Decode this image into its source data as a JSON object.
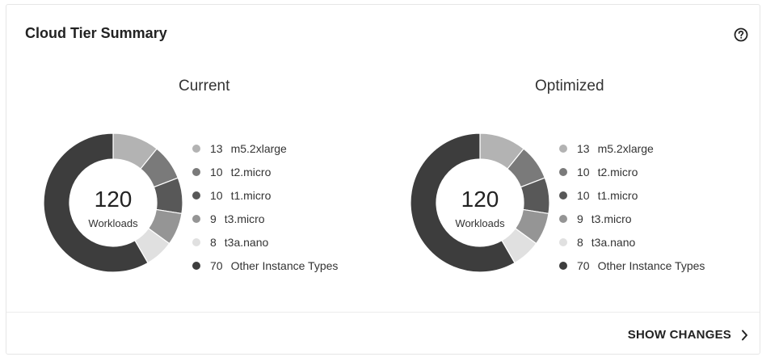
{
  "card": {
    "title": "Cloud Tier Summary",
    "help_icon": "help-circle-icon"
  },
  "footer": {
    "link_label": "SHOW CHANGES",
    "link_icon": "chevron-right-icon"
  },
  "colors": {
    "m5.2xlarge": "#b3b3b3",
    "t2.micro": "#7a7a7a",
    "t1.micro": "#585858",
    "t3.micro": "#959595",
    "t3a.nano": "#e0e0e0",
    "Other Instance Types": "#3d3d3d"
  },
  "panels": [
    {
      "title": "Current",
      "center_value": "120",
      "center_label": "Workloads",
      "legend": [
        {
          "count": "13",
          "name": "m5.2xlarge"
        },
        {
          "count": "10",
          "name": "t2.micro"
        },
        {
          "count": "10",
          "name": "t1.micro"
        },
        {
          "count": "9",
          "name": "t3.micro"
        },
        {
          "count": "8",
          "name": "t3a.nano"
        },
        {
          "count": "70",
          "name": "Other Instance Types"
        }
      ]
    },
    {
      "title": "Optimized",
      "center_value": "120",
      "center_label": "Workloads",
      "legend": [
        {
          "count": "13",
          "name": "m5.2xlarge"
        },
        {
          "count": "10",
          "name": "t2.micro"
        },
        {
          "count": "10",
          "name": "t1.micro"
        },
        {
          "count": "9",
          "name": "t3.micro"
        },
        {
          "count": "8",
          "name": "t3a.nano"
        },
        {
          "count": "70",
          "name": "Other Instance Types"
        }
      ]
    }
  ],
  "chart_data": [
    {
      "type": "pie",
      "title": "Current",
      "categories": [
        "m5.2xlarge",
        "t2.micro",
        "t1.micro",
        "t3.micro",
        "t3a.nano",
        "Other Instance Types"
      ],
      "values": [
        13,
        10,
        10,
        9,
        8,
        70
      ],
      "total": 120,
      "total_label": "Workloads",
      "legend": "right"
    },
    {
      "type": "pie",
      "title": "Optimized",
      "categories": [
        "m5.2xlarge",
        "t2.micro",
        "t1.micro",
        "t3.micro",
        "t3a.nano",
        "Other Instance Types"
      ],
      "values": [
        13,
        10,
        10,
        9,
        8,
        70
      ],
      "total": 120,
      "total_label": "Workloads",
      "legend": "right"
    }
  ]
}
